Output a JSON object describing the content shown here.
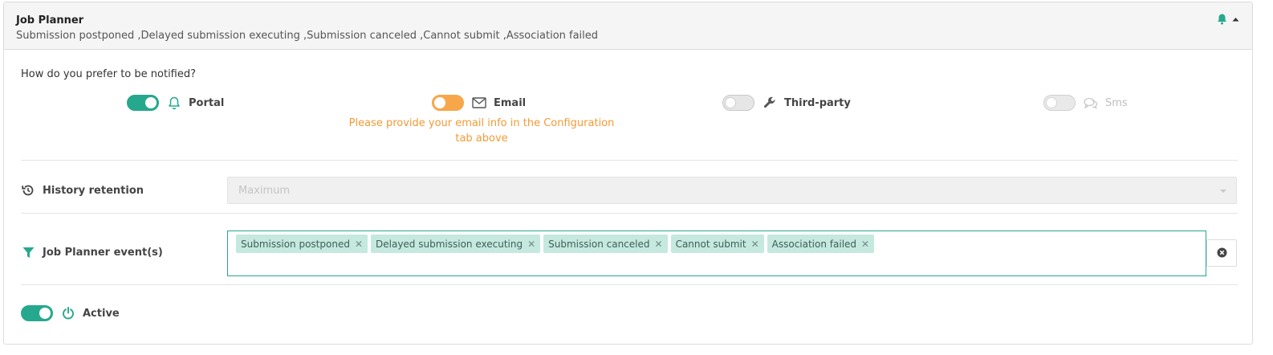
{
  "header": {
    "title": "Job Planner",
    "subtitle": "Submission postponed ,Delayed submission executing ,Submission canceled ,Cannot submit ,Association failed",
    "icons": [
      "bell-icon",
      "caret-up-icon"
    ]
  },
  "notify": {
    "question": "How do you prefer to be notified?",
    "channels": [
      {
        "label": "Portal",
        "state": "on",
        "icon": "bell-outline-icon"
      },
      {
        "label": "Email",
        "state": "warning",
        "icon": "envelope-icon"
      },
      {
        "label": "Third-party",
        "state": "off",
        "icon": "wrench-icon"
      },
      {
        "label": "Sms",
        "state": "disabled",
        "icon": "chat-icon"
      }
    ],
    "email_warning": "Please provide your email info in the Configuration tab above"
  },
  "history": {
    "label": "History retention",
    "value": "Maximum"
  },
  "events": {
    "label": "Job Planner event(s)",
    "tags": [
      "Submission postponed",
      "Delayed submission executing",
      "Submission canceled",
      "Cannot submit",
      "Association failed"
    ]
  },
  "active": {
    "label": "Active",
    "state": "on"
  },
  "colors": {
    "accent": "#26a88e",
    "warning": "#f7a74a",
    "warning_text": "#f39a35",
    "tag_bg": "#c5e8df"
  }
}
